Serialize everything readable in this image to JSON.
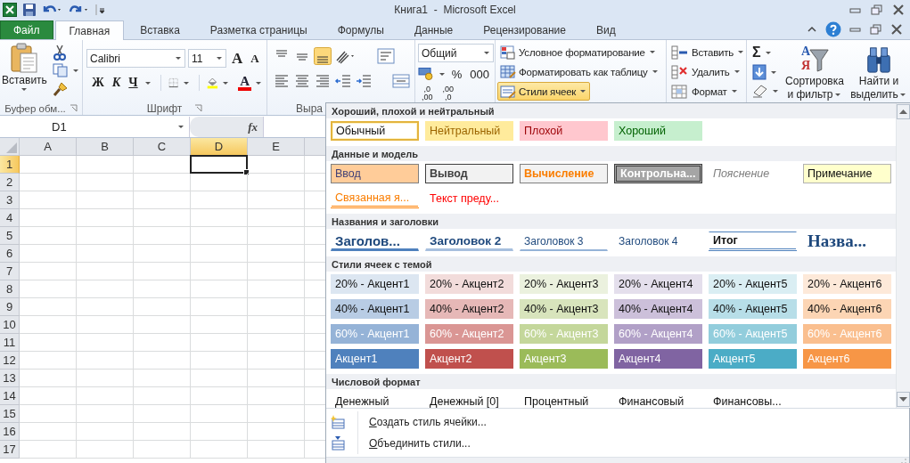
{
  "title_bar": {
    "title": "Книга1  -  Microsoft Excel"
  },
  "ribbon_tabs": [
    {
      "label": "Файл",
      "kind": "file",
      "selected": false
    },
    {
      "label": "Главная",
      "kind": "tab",
      "selected": true
    },
    {
      "label": "Вставка",
      "kind": "tab",
      "selected": false
    },
    {
      "label": "Разметка страницы",
      "kind": "tab",
      "selected": false
    },
    {
      "label": "Формулы",
      "kind": "tab",
      "selected": false
    },
    {
      "label": "Данные",
      "kind": "tab",
      "selected": false
    },
    {
      "label": "Рецензирование",
      "kind": "tab",
      "selected": false
    },
    {
      "label": "Вид",
      "kind": "tab",
      "selected": false
    }
  ],
  "clipboard": {
    "paste_label": "Вставить",
    "group_label": "Буфер обм..."
  },
  "font": {
    "name": "Calibri",
    "size": "11",
    "grow": "A",
    "shrink": "A",
    "bold": "Ж",
    "italic": "К",
    "underline": "Ч",
    "font_color": "A",
    "group_label": "Шрифт"
  },
  "alignment": {
    "group_label": "Выра",
    "bottom_align_on": true
  },
  "number": {
    "format": "Общий",
    "percent": "%",
    "thousands": "000",
    "decimals": [
      {
        "top": ",0",
        "bottom": ",00"
      },
      {
        "top": ",00",
        "bottom": ",0"
      }
    ]
  },
  "styles": {
    "buttons": [
      {
        "label": "Условное форматирование",
        "kind": "conditional",
        "pressed": false
      },
      {
        "label": "Форматировать как таблицу",
        "kind": "table",
        "pressed": false
      },
      {
        "label": "Стили ячеек",
        "kind": "cellstyles",
        "pressed": true
      }
    ]
  },
  "cells": {
    "buttons": [
      {
        "label": "Вставить",
        "kind": "insert"
      },
      {
        "label": "Удалить",
        "kind": "delete"
      },
      {
        "label": "Формат",
        "kind": "format"
      }
    ]
  },
  "editing": {
    "sum": "Σ",
    "sort_letters": [
      "А",
      "Я"
    ],
    "sort_label": [
      "Сортировка",
      "и фильтр"
    ],
    "find_label": [
      "Найти и",
      "выделить"
    ]
  },
  "formula_bar": {
    "name_box": "D1",
    "fx": "fx"
  },
  "sheet": {
    "columns": [
      {
        "label": "A",
        "selected": false
      },
      {
        "label": "B",
        "selected": false
      },
      {
        "label": "C",
        "selected": false
      },
      {
        "label": "D",
        "selected": true
      },
      {
        "label": "E",
        "selected": false
      }
    ],
    "rows": [
      {
        "label": "1",
        "selected": true
      },
      {
        "label": "2",
        "selected": false
      },
      {
        "label": "3",
        "selected": false
      },
      {
        "label": "4",
        "selected": false
      },
      {
        "label": "5",
        "selected": false
      },
      {
        "label": "6",
        "selected": false
      },
      {
        "label": "7",
        "selected": false
      },
      {
        "label": "8",
        "selected": false
      },
      {
        "label": "9",
        "selected": false
      },
      {
        "label": "10",
        "selected": false
      },
      {
        "label": "11",
        "selected": false
      },
      {
        "label": "12",
        "selected": false
      },
      {
        "label": "13",
        "selected": false
      },
      {
        "label": "14",
        "selected": false
      },
      {
        "label": "15",
        "selected": false
      },
      {
        "label": "16",
        "selected": false
      },
      {
        "label": "17",
        "selected": false
      }
    ]
  },
  "cell_styles_gallery": {
    "sections": [
      {
        "title": "Хороший, плохой и нейтральный",
        "items": [
          {
            "label": "Обычный",
            "kind": "normal",
            "selected": true
          },
          {
            "label": "Нейтральный",
            "kind": "neutral",
            "selected": false
          },
          {
            "label": "Плохой",
            "kind": "bad",
            "selected": false
          },
          {
            "label": "Хороший",
            "kind": "good",
            "selected": false
          }
        ]
      },
      {
        "title": "Данные и модель",
        "items": [
          {
            "label": "Ввод",
            "kind": "input",
            "selected": false
          },
          {
            "label": "Вывод",
            "kind": "output",
            "selected": false
          },
          {
            "label": "Вычисление",
            "kind": "calculation",
            "selected": false
          },
          {
            "label": "Контрольна...",
            "kind": "check",
            "selected": false
          },
          {
            "label": "Пояснение",
            "kind": "explanatory",
            "selected": false
          },
          {
            "label": "Примечание",
            "kind": "note",
            "selected": false
          },
          {
            "label": "Связанная я...",
            "kind": "linked",
            "selected": false
          },
          {
            "label": "Текст преду...",
            "kind": "warning",
            "selected": false
          }
        ]
      },
      {
        "title": "Названия и заголовки",
        "items": [
          {
            "label": "Заголов...",
            "kind": "h1",
            "selected": false
          },
          {
            "label": "Заголовок 2",
            "kind": "h2",
            "selected": false
          },
          {
            "label": "Заголовок 3",
            "kind": "h3",
            "selected": false
          },
          {
            "label": "Заголовок 4",
            "kind": "h4",
            "selected": false
          },
          {
            "label": "Итог",
            "kind": "total",
            "selected": false
          },
          {
            "label": "Назва...",
            "kind": "title",
            "selected": false
          }
        ]
      },
      {
        "title": "Стили ячеек с темой",
        "items": [
          {
            "label": "20% - Акцент1",
            "kind": "accent_light",
            "color": "#dce6f1",
            "selected": false
          },
          {
            "label": "20% - Акцент2",
            "kind": "accent_light",
            "color": "#f2dcdb",
            "selected": false
          },
          {
            "label": "20% - Акцент3",
            "kind": "accent_light",
            "color": "#ebf1de",
            "selected": false
          },
          {
            "label": "20% - Акцент4",
            "kind": "accent_light",
            "color": "#e4dfec",
            "selected": false
          },
          {
            "label": "20% - Акцент5",
            "kind": "accent_light",
            "color": "#daeef3",
            "selected": false
          },
          {
            "label": "20% - Акцент6",
            "kind": "accent_light",
            "color": "#fde9d9",
            "selected": false
          },
          {
            "label": "40% - Акцент1",
            "kind": "accent_light",
            "color": "#b8cce4",
            "selected": false
          },
          {
            "label": "40% - Акцент2",
            "kind": "accent_light",
            "color": "#e6b8b7",
            "selected": false
          },
          {
            "label": "40% - Акцент3",
            "kind": "accent_light",
            "color": "#d8e4bc",
            "selected": false
          },
          {
            "label": "40% - Акцент4",
            "kind": "accent_light",
            "color": "#ccc0da",
            "selected": false
          },
          {
            "label": "40% - Акцент5",
            "kind": "accent_light",
            "color": "#b7dee8",
            "selected": false
          },
          {
            "label": "40% - Акцент6",
            "kind": "accent_light",
            "color": "#fcd5b4",
            "selected": false
          },
          {
            "label": "60% - Акцент1",
            "kind": "accent_dark",
            "color": "#95b3d7",
            "selected": false
          },
          {
            "label": "60% - Акцент2",
            "kind": "accent_dark",
            "color": "#da9694",
            "selected": false
          },
          {
            "label": "60% - Акцент3",
            "kind": "accent_dark",
            "color": "#c4d79b",
            "selected": false
          },
          {
            "label": "60% - Акцент4",
            "kind": "accent_dark",
            "color": "#b1a0c7",
            "selected": false
          },
          {
            "label": "60% - Акцент5",
            "kind": "accent_dark",
            "color": "#92cddc",
            "selected": false
          },
          {
            "label": "60% - Акцент6",
            "kind": "accent_dark",
            "color": "#fabf8f",
            "selected": false
          },
          {
            "label": "Акцент1",
            "kind": "accent_dark",
            "color": "#4f81bd",
            "selected": false
          },
          {
            "label": "Акцент2",
            "kind": "accent_dark",
            "color": "#c0504d",
            "selected": false
          },
          {
            "label": "Акцент3",
            "kind": "accent_dark",
            "color": "#9bbb59",
            "selected": false
          },
          {
            "label": "Акцент4",
            "kind": "accent_dark",
            "color": "#8064a2",
            "selected": false
          },
          {
            "label": "Акцент5",
            "kind": "accent_dark",
            "color": "#4bacc6",
            "selected": false
          },
          {
            "label": "Акцент6",
            "kind": "accent_dark",
            "color": "#f79646",
            "selected": false
          }
        ]
      },
      {
        "title": "Числовой формат",
        "items": [
          {
            "label": "Денежный",
            "kind": "plain",
            "selected": false
          },
          {
            "label": "Денежный [0]",
            "kind": "plain",
            "selected": false
          },
          {
            "label": "Процентный",
            "kind": "plain",
            "selected": false
          },
          {
            "label": "Финансовый",
            "kind": "plain",
            "selected": false
          },
          {
            "label": "Финансовы...",
            "kind": "plain",
            "selected": false
          }
        ]
      }
    ],
    "menu": [
      {
        "label": "Создать стиль ячейки...",
        "kind": "new"
      },
      {
        "label": "Объединить стили...",
        "kind": "merge"
      }
    ]
  }
}
